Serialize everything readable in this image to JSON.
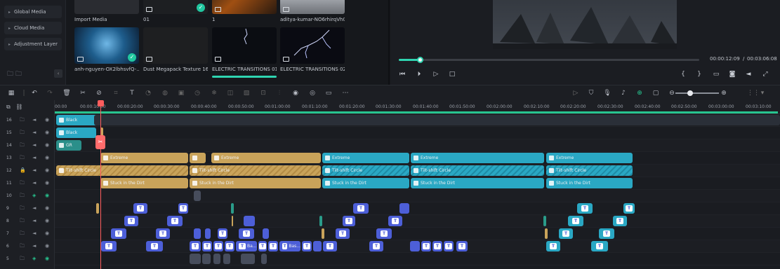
{
  "sidebar": {
    "items": [
      {
        "label": "Global Media"
      },
      {
        "label": "Cloud Media"
      },
      {
        "label": "Adjustment Layer"
      }
    ]
  },
  "media": {
    "row1": [
      {
        "label": "Import Media"
      },
      {
        "label": "01"
      },
      {
        "label": "1"
      },
      {
        "label": "aditya-kumar-NO6rhirqVh0-..."
      }
    ],
    "row2": [
      {
        "label": "anh-nguyen-OX2lbhsvfQ-..."
      },
      {
        "label": "Dust Megapack Texture 16"
      },
      {
        "label": "ELECTRIC TRANSITIONS 01 4K"
      },
      {
        "label": "ELECTRIC TRANSITIONS 02 4K"
      }
    ]
  },
  "player": {
    "current_time": "00:00:12:09",
    "total_time": "00:03:06:08",
    "progress": 0.07,
    "separator": "/"
  },
  "ruler": {
    "labels": [
      "00:00",
      "00:00:10:00",
      "00:00:20:00",
      "00:00:30:00",
      "00:00:40:00",
      "00:00:50:00",
      "00:01:00:00",
      "00:01:10:00",
      "00:01:20:00",
      "00:01:30:00",
      "00:01:40:00",
      "00:01:50:00",
      "00:02:00:00",
      "00:02:10:00",
      "00:02:20:00",
      "00:02:30:00",
      "00:02:40:00",
      "00:02:50:00",
      "00:03:00:00",
      "00:03:10:00"
    ]
  },
  "tracks": {
    "t16": "16",
    "t15": "15",
    "t14": "14",
    "t13": "13",
    "t12": "12",
    "t11": "11",
    "t10": "10",
    "t9": "9",
    "t8": "8",
    "t7": "7",
    "t6": "6",
    "t5": "5"
  },
  "clips": {
    "black1": "Black",
    "black2": "Black",
    "gr": "GR",
    "extreme": "Extreme",
    "tilt": "Tilt-shift Circle",
    "dirt": "Stuck in the Dirt",
    "ba": "Ba...",
    "bas": "Bas..."
  },
  "text_glyph": "T",
  "colors": {
    "accent": "#27c48f",
    "playhead": "#ff5d5d",
    "teal_clip": "#2aa8c4",
    "gold_clip": "#c9a35a",
    "title_clip": "#4d5fd8"
  }
}
